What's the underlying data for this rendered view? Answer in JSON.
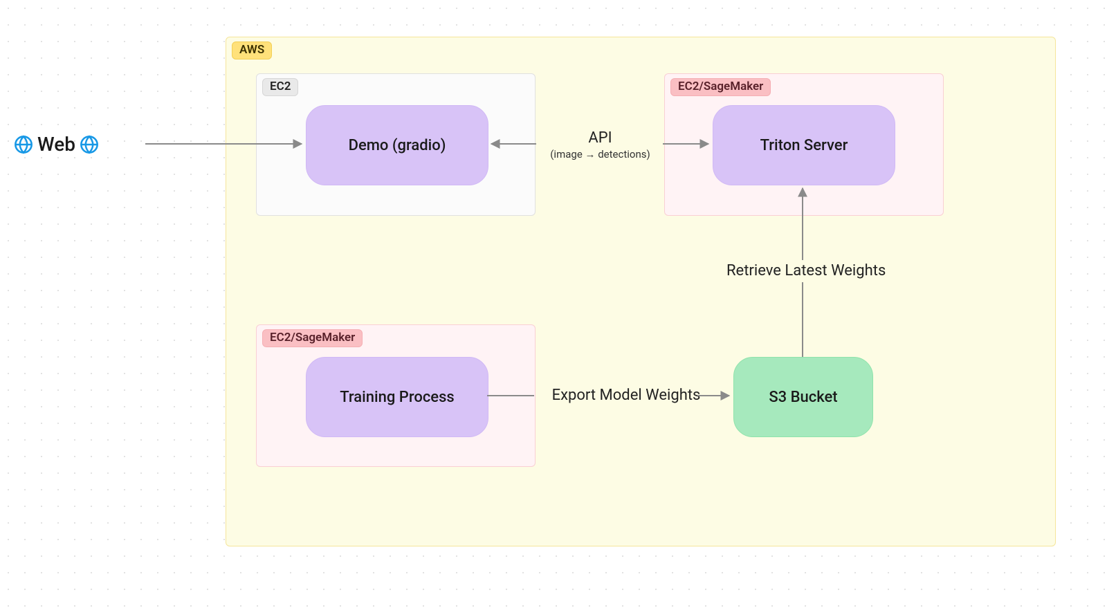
{
  "nodes": {
    "web": "Web",
    "aws": "AWS",
    "ec2": "EC2",
    "ec2_sagemaker_top": "EC2/SageMaker",
    "ec2_sagemaker_bottom": "EC2/SageMaker",
    "demo": "Demo (gradio)",
    "triton": "Triton Server",
    "training": "Training Process",
    "s3": "S3 Bucket"
  },
  "edges": {
    "api_title": "API",
    "api_sub": "(image → detections)",
    "retrieve": "Retrieve Latest Weights",
    "export": "Export Model Weights"
  },
  "colors": {
    "aws_bg": "#fdfce4",
    "aws_border": "#f5e59a",
    "aws_tag_bg": "#ffe17a",
    "aws_tag_border": "#f2cf55",
    "ec2_bg": "#fbfbfb",
    "ec2_border": "#e0e0e0",
    "ec2_tag_bg": "#e9e9e9",
    "ec2_tag_border": "#d6d6d6",
    "sage_bg": "#fff3f5",
    "sage_border": "#f9cfd4",
    "sage_tag_bg": "#fabfc3",
    "sage_tag_border": "#f5aeb3",
    "arrow": "#8a8a8a"
  }
}
